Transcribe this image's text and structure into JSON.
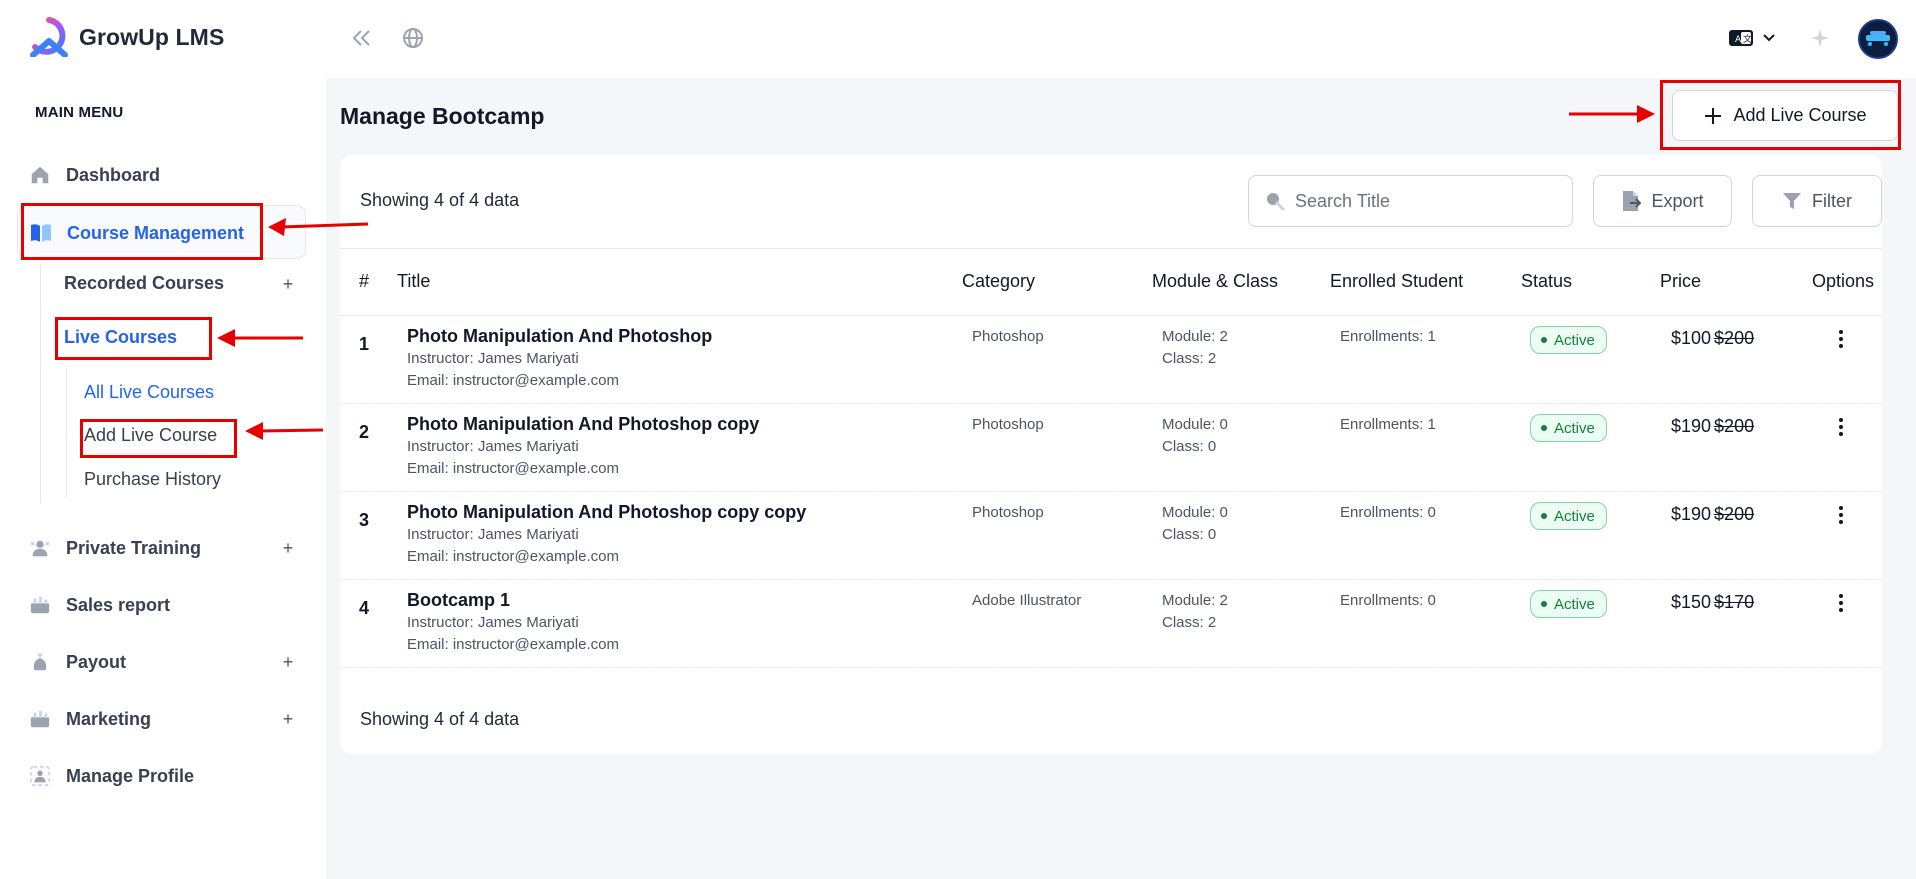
{
  "app": {
    "name": "GrowUp LMS"
  },
  "sidebar": {
    "heading": "MAIN MENU",
    "dashboard": "Dashboard",
    "course_management": "Course Management",
    "recorded_courses": "Recorded Courses",
    "live_courses": "Live Courses",
    "all_live_courses": "All Live Courses",
    "add_live_course": "Add Live Course",
    "purchase_history": "Purchase History",
    "private_training": "Private Training",
    "sales_report": "Sales report",
    "payout": "Payout",
    "marketing": "Marketing",
    "manage_profile": "Manage Profile",
    "plus": "+",
    "minus": "–"
  },
  "main": {
    "title": "Manage Bootcamp",
    "add_button": "Add Live Course",
    "showing_top": "Showing 4 of 4 data",
    "showing_bottom": "Showing 4 of 4 data",
    "search_placeholder": "Search Title",
    "export_label": "Export",
    "filter_label": "Filter"
  },
  "table": {
    "headers": [
      "#",
      "Title",
      "Category",
      "Module & Class",
      "Enrolled Student",
      "Status",
      "Price",
      "Options"
    ],
    "rows": [
      {
        "num": "1",
        "title": "Photo Manipulation And Photoshop",
        "instructor": "Instructor: James Mariyati",
        "email": "Email: instructor@example.com",
        "category": "Photoshop",
        "module": "Module: 2",
        "class": "Class: 2",
        "enrolled": "Enrollments: 1",
        "status": "Active",
        "price": "$100",
        "old_price": "$200"
      },
      {
        "num": "2",
        "title": "Photo Manipulation And Photoshop copy",
        "instructor": "Instructor: James Mariyati",
        "email": "Email: instructor@example.com",
        "category": "Photoshop",
        "module": "Module: 0",
        "class": "Class: 0",
        "enrolled": "Enrollments: 1",
        "status": "Active",
        "price": "$190",
        "old_price": "$200"
      },
      {
        "num": "3",
        "title": "Photo Manipulation And Photoshop copy copy",
        "instructor": "Instructor: James Mariyati",
        "email": "Email: instructor@example.com",
        "category": "Photoshop",
        "module": "Module: 0",
        "class": "Class: 0",
        "enrolled": "Enrollments: 0",
        "status": "Active",
        "price": "$190",
        "old_price": "$200"
      },
      {
        "num": "4",
        "title": "Bootcamp 1",
        "instructor": "Instructor: James Mariyati",
        "email": "Email: instructor@example.com",
        "category": "Adobe Illustrator",
        "module": "Module: 2",
        "class": "Class: 2",
        "enrolled": "Enrollments: 0",
        "status": "Active",
        "price": "$150",
        "old_price": "$170"
      }
    ]
  },
  "colors": {
    "accent": "#2563eb",
    "annotation": "#e60000",
    "status_active": "#15803d",
    "background": "#f5f6fa"
  }
}
